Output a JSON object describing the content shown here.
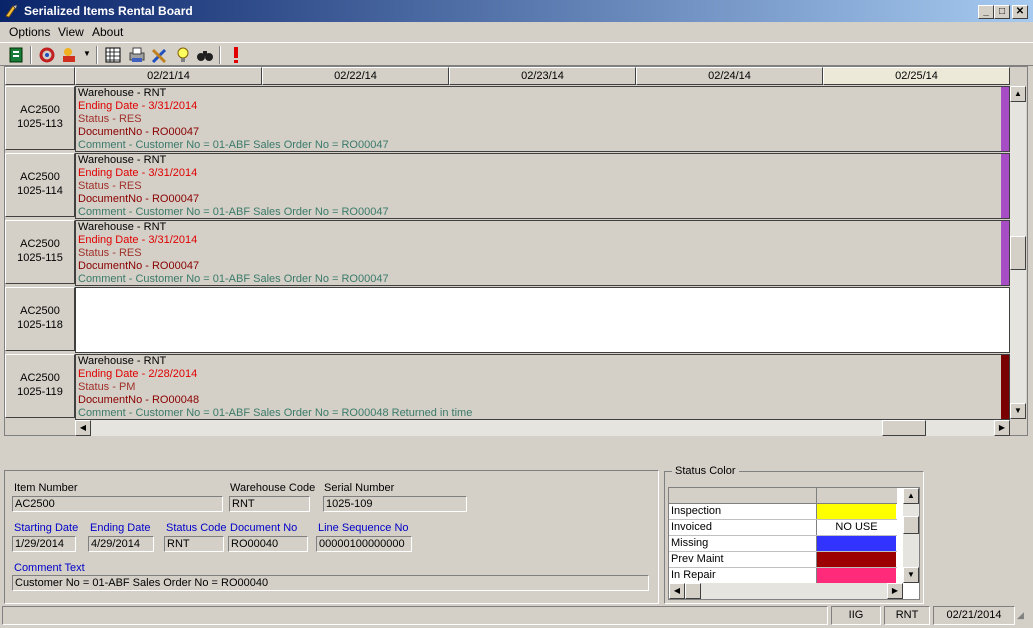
{
  "window": {
    "title": "Serialized Items Rental Board"
  },
  "menu": {
    "items": [
      "Options",
      "View",
      "About"
    ]
  },
  "toolbar": {
    "icons": [
      "export-icon",
      "refresh-icon",
      "users-icon",
      "dropdown-arrow-icon",
      "grid-icon",
      "print-icon",
      "tools-icon",
      "lightbulb-icon",
      "binoculars-icon",
      "alert-icon"
    ]
  },
  "board": {
    "dates": [
      "02/21/14",
      "02/22/14",
      "02/23/14",
      "02/24/14",
      "02/25/14"
    ],
    "rows": [
      {
        "item": "AC2500",
        "serial": "1025-113",
        "warehouse": "Warehouse - RNT",
        "ending": "Ending Date - 3/31/2014",
        "status": "Status - RES",
        "doc": "DocumentNo - RO00047",
        "comment": "Comment - Customer No = 01-ABF Sales Order No = RO00047",
        "strip": "#a64cc4"
      },
      {
        "item": "AC2500",
        "serial": "1025-114",
        "warehouse": "Warehouse - RNT",
        "ending": "Ending Date - 3/31/2014",
        "status": "Status - RES",
        "doc": "DocumentNo - RO00047",
        "comment": "Comment - Customer No = 01-ABF Sales Order No = RO00047",
        "strip": "#a64cc4"
      },
      {
        "item": "AC2500",
        "serial": "1025-115",
        "warehouse": "Warehouse - RNT",
        "ending": "Ending Date - 3/31/2014",
        "status": "Status - RES",
        "doc": "DocumentNo - RO00047",
        "comment": "Comment - Customer No = 01-ABF Sales Order No = RO00047",
        "strip": "#a64cc4"
      },
      {
        "item": "AC2500",
        "serial": "1025-118",
        "warehouse": "",
        "ending": "",
        "status": "",
        "doc": "",
        "comment": "",
        "strip": ""
      },
      {
        "item": "AC2500",
        "serial": "1025-119",
        "warehouse": "Warehouse - RNT",
        "ending": "Ending Date - 2/28/2014",
        "status": "Status - PM",
        "doc": "DocumentNo - RO00048",
        "comment": "Comment - Customer No = 01-ABF Sales Order No = RO00048 Returned in time",
        "strip": "#7a0000"
      }
    ]
  },
  "detail": {
    "item_number_label": "Item Number",
    "item_number": "AC2500",
    "warehouse_code_label": "Warehouse Code",
    "warehouse_code": "RNT",
    "serial_number_label": "Serial Number",
    "serial_number": "1025-109",
    "starting_date_label": "Starting Date",
    "starting_date": "1/29/2014",
    "ending_date_label": "Ending Date",
    "ending_date": "4/29/2014",
    "status_code_label": "Status Code",
    "status_code": "RNT",
    "document_no_label": "Document No",
    "document_no": "RO00040",
    "line_seq_label": "Line Sequence No",
    "line_seq": "00000100000000",
    "comment_label": "Comment Text",
    "comment": "Customer No = 01-ABF Sales Order No = RO00040"
  },
  "status_color": {
    "title": "Status Color",
    "items": [
      {
        "name": "Inspection",
        "color": "#ffff00",
        "text": ""
      },
      {
        "name": "Invoiced",
        "color": "#ffffff",
        "text": "NO USE"
      },
      {
        "name": "Missing",
        "color": "#3333ff",
        "text": ""
      },
      {
        "name": "Prev Maint",
        "color": "#9c0000",
        "text": ""
      },
      {
        "name": "In Repair",
        "color": "#ff2a7a",
        "text": ""
      }
    ]
  },
  "statusbar": {
    "company": "IIG",
    "warehouse": "RNT",
    "date": "02/21/2014"
  }
}
